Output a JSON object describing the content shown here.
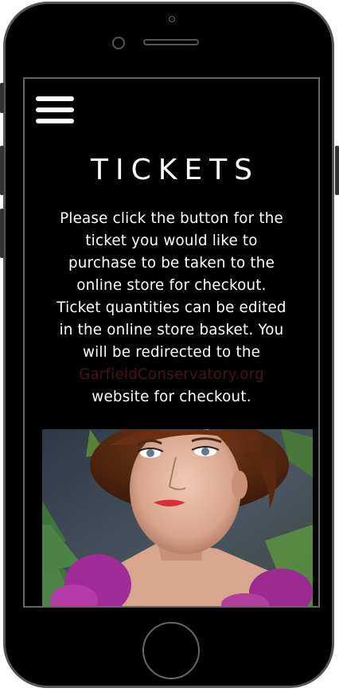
{
  "page": {
    "title": "TICKETS",
    "description_lines": [
      "Please click the button for the",
      "ticket you would like to",
      "purchase to be taken to the",
      "online store for checkout.",
      "Ticket quantities can be edited",
      "in the online store basket. You",
      "will be redirected to the"
    ],
    "link_text": "GarfieldConservatory.org",
    "description_end": "website for checkout."
  },
  "icons": {
    "menu": "hamburger-menu-icon"
  },
  "colors": {
    "background": "#000000",
    "text": "#ffffff",
    "link": "#4a1414"
  }
}
